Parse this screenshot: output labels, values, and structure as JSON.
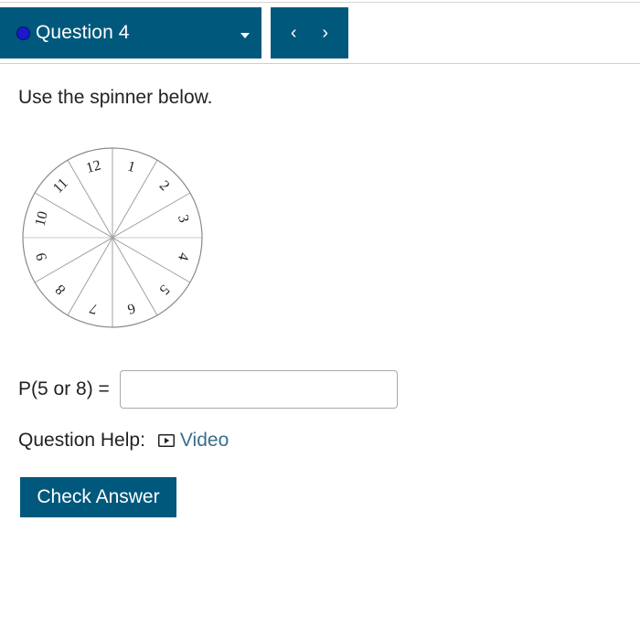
{
  "header": {
    "question_label": "Question 4",
    "status_color": "#1a1acc",
    "accent": "#00587c",
    "nav": {
      "prev_label": "‹",
      "next_label": "›"
    }
  },
  "question": {
    "prompt": "Use the spinner below.",
    "spinner": {
      "numbers": [
        "1",
        "2",
        "3",
        "4",
        "5",
        "6",
        "7",
        "8",
        "9",
        "10",
        "11",
        "12"
      ]
    },
    "answer_label": "P(5 or 8) =",
    "answer_value": ""
  },
  "help": {
    "label": "Question Help:",
    "video_label": "Video",
    "video_icon": "play-video-icon"
  },
  "actions": {
    "check_label": "Check Answer"
  }
}
